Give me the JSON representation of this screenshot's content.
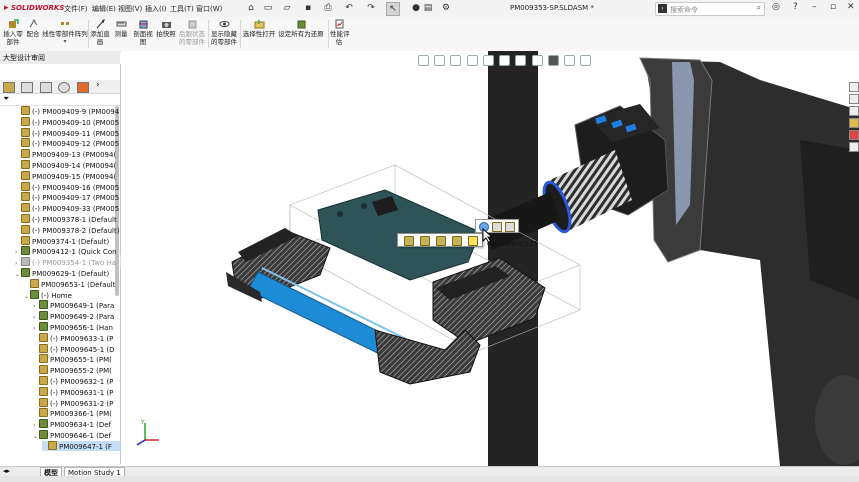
{
  "app": {
    "logo": "SOLIDWORKS",
    "document_title": "PM009353-SP.SLDASM *"
  },
  "menu": [
    "文件(F)",
    "编辑(E)",
    "视图(V)",
    "插入(I)",
    "工具(T)",
    "窗口(W)"
  ],
  "search": {
    "placeholder": "搜索命令"
  },
  "ribbon": {
    "buttons": [
      {
        "label": "插入零\n部件",
        "icon": "insert-component-icon"
      },
      {
        "label": "配合",
        "icon": "mate-icon"
      },
      {
        "label": "线性零部件阵列",
        "icon": "linear-pattern-icon"
      },
      {
        "label": "添加直\n画",
        "icon": "add-line-icon"
      },
      {
        "label": "测量",
        "icon": "measure-icon"
      },
      {
        "label": "剖面视\n图",
        "icon": "section-view-icon"
      },
      {
        "label": "拍快照",
        "icon": "snapshot-icon"
      },
      {
        "label": "后跟状态\n的零部件",
        "icon": "component-state-icon"
      },
      {
        "label": "显示隐藏\n的零部件",
        "icon": "show-hidden-icon"
      },
      {
        "label": "选择性打开",
        "icon": "selective-open-icon"
      },
      {
        "label": "设定所有为还原",
        "icon": "set-resolved-icon"
      },
      {
        "label": "性能评\n估",
        "icon": "performance-icon"
      }
    ]
  },
  "left_panel": {
    "header": "大型设计审阅",
    "tree": [
      {
        "label": "(-) PM009409-9 (PM0094",
        "indent": 1,
        "icon": "part"
      },
      {
        "label": "(-) PM009409-10 (PM005",
        "indent": 1,
        "icon": "part"
      },
      {
        "label": "(-) PM009409-11 (PM005",
        "indent": 1,
        "icon": "part"
      },
      {
        "label": "(-) PM009409-12 (PM005",
        "indent": 1,
        "icon": "part"
      },
      {
        "label": "PM009409-13 (PM0094(",
        "indent": 1,
        "icon": "part"
      },
      {
        "label": "PM009409-14 (PM0094(",
        "indent": 1,
        "icon": "part"
      },
      {
        "label": "PM009409-15 (PM0094(",
        "indent": 1,
        "icon": "part"
      },
      {
        "label": "(-) PM009409-16 (PM005",
        "indent": 1,
        "icon": "part"
      },
      {
        "label": "(-) PM009409-17 (PM005",
        "indent": 1,
        "icon": "part"
      },
      {
        "label": "(-) PM009409-33 (PM005",
        "indent": 1,
        "icon": "part"
      },
      {
        "label": "(-) PM009378-1 (Default",
        "indent": 1,
        "icon": "part"
      },
      {
        "label": "(-) PM009378-2 (Default)",
        "indent": 1,
        "icon": "part"
      },
      {
        "label": "PM009374-1 (Default)",
        "indent": 1,
        "icon": "part"
      },
      {
        "label": "PM009412-1 (Quick Con",
        "indent": 1,
        "icon": "asm",
        "expand": "›"
      },
      {
        "label": "(-) PM009354-1 (Two Ha",
        "indent": 1,
        "icon": "sub",
        "expand": "›",
        "muted": true
      },
      {
        "label": "PM009629-1 (Default)",
        "indent": 1,
        "icon": "asm",
        "expand": "⌄"
      },
      {
        "label": "PM009653-1 (Default",
        "indent": 2,
        "icon": "part"
      },
      {
        "label": "(-) Home",
        "indent": 2,
        "icon": "asm",
        "expand": "⌄"
      },
      {
        "label": "PM009649-1 (Para",
        "indent": 3,
        "icon": "asm",
        "expand": "›"
      },
      {
        "label": "PM009649-2 (Para",
        "indent": 3,
        "icon": "asm",
        "expand": "›"
      },
      {
        "label": "PM009656-1 (Han",
        "indent": 3,
        "icon": "asm",
        "expand": "›"
      },
      {
        "label": "(-) PM009633-1 (P",
        "indent": 3,
        "icon": "part"
      },
      {
        "label": "(-) PM009645-1 (D",
        "indent": 3,
        "icon": "part"
      },
      {
        "label": "PM009655-1 (PM(",
        "indent": 3,
        "icon": "part"
      },
      {
        "label": "PM009655-2 (PM(",
        "indent": 3,
        "icon": "part"
      },
      {
        "label": "(-) PM009632-1 (P",
        "indent": 3,
        "icon": "part"
      },
      {
        "label": "(-) PM009631-1 (P",
        "indent": 3,
        "icon": "part"
      },
      {
        "label": "(-) PM009631-2 (P",
        "indent": 3,
        "icon": "part"
      },
      {
        "label": "PM009366-1 (PM(",
        "indent": 3,
        "icon": "part"
      },
      {
        "label": "PM009634-1 (Def",
        "indent": 3,
        "icon": "asm",
        "expand": "›"
      },
      {
        "label": "PM009646-1 (Def",
        "indent": 3,
        "icon": "asm",
        "expand": "⌄"
      },
      {
        "label": "PM009647-1 (F",
        "indent": 4,
        "icon": "part",
        "selected": true
      }
    ]
  },
  "tabs": {
    "model": "模型",
    "motion": "Motion Study 1"
  },
  "viewport": {
    "tooltip": "Concentric125"
  },
  "colors": {
    "accent_red": "#c8102e",
    "selection": "#c6ddf7",
    "plate": "#2e5457",
    "rod_blue": "#1e8bd6"
  }
}
